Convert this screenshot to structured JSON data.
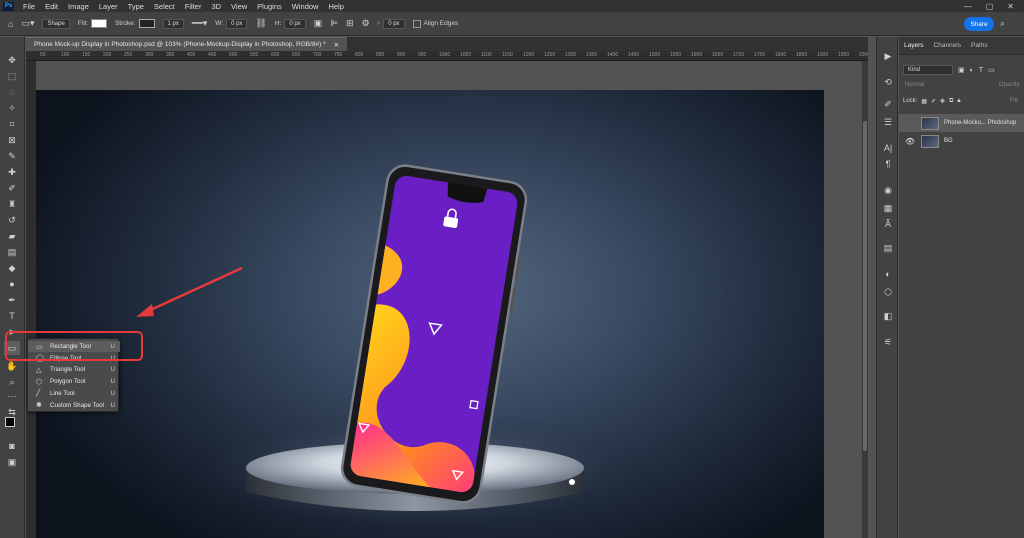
{
  "menubar": {
    "app_icon": "Ps",
    "items": [
      "File",
      "Edit",
      "Image",
      "Layer",
      "Type",
      "Select",
      "Filter",
      "3D",
      "View",
      "Plugins",
      "Window",
      "Help"
    ],
    "window_controls": [
      "—",
      "▢",
      "✕"
    ]
  },
  "options": {
    "mode": "Shape",
    "fill_label": "Fill:",
    "stroke_label": "Stroke:",
    "stroke_width": "1 px",
    "w_label": "W:",
    "w_value": "0 px",
    "h_label": "H:",
    "h_value": "0 px",
    "corner_value": "0 px",
    "align_edges": "Align Edges",
    "share": "Share"
  },
  "document": {
    "tab_title": "Phone Mock-up Display in Photoshop.psd @ 103% (Phone-Mockup-Display in Photoshop, RGB/8#) *",
    "close": "✕",
    "ruler_ticks": [
      "50",
      "100",
      "150",
      "200",
      "250",
      "300",
      "350",
      "400",
      "450",
      "500",
      "550",
      "600",
      "650",
      "700",
      "750",
      "800",
      "850",
      "900",
      "950",
      "1000",
      "1050",
      "1100",
      "1150",
      "1200",
      "1250",
      "1300",
      "1350",
      "1400",
      "1450",
      "1500",
      "1550",
      "1600",
      "1650",
      "1700",
      "1750",
      "1800",
      "1850",
      "1900",
      "1950",
      "2000"
    ]
  },
  "flyout": {
    "items": [
      {
        "label": "Rectangle Tool",
        "key": "U",
        "icon": "rectangle-icon",
        "active": true
      },
      {
        "label": "Ellipse Tool",
        "key": "U",
        "icon": "ellipse-icon"
      },
      {
        "label": "Triangle Tool",
        "key": "U",
        "icon": "triangle-icon"
      },
      {
        "label": "Polygon Tool",
        "key": "U",
        "icon": "polygon-icon"
      },
      {
        "label": "Line Tool",
        "key": "U",
        "icon": "line-icon"
      },
      {
        "label": "Custom Shape Tool",
        "key": "U",
        "icon": "custom-shape-icon"
      }
    ]
  },
  "layers_panel": {
    "tabs": [
      "Layers",
      "Channels",
      "Paths"
    ],
    "filter_label": "Kind",
    "blend_mode": "Normal",
    "opacity_label": "Opacity:",
    "lock_label": "Lock:",
    "fill_label": "Fill:",
    "layers": [
      {
        "name": "Phone-Mocku... Photoshop",
        "selected": true
      },
      {
        "name": "BG",
        "selected": false
      }
    ]
  },
  "colors": {
    "accent": "#1473e6",
    "callout": "#e53a3a",
    "phone_screen": "#6a1fc4"
  }
}
